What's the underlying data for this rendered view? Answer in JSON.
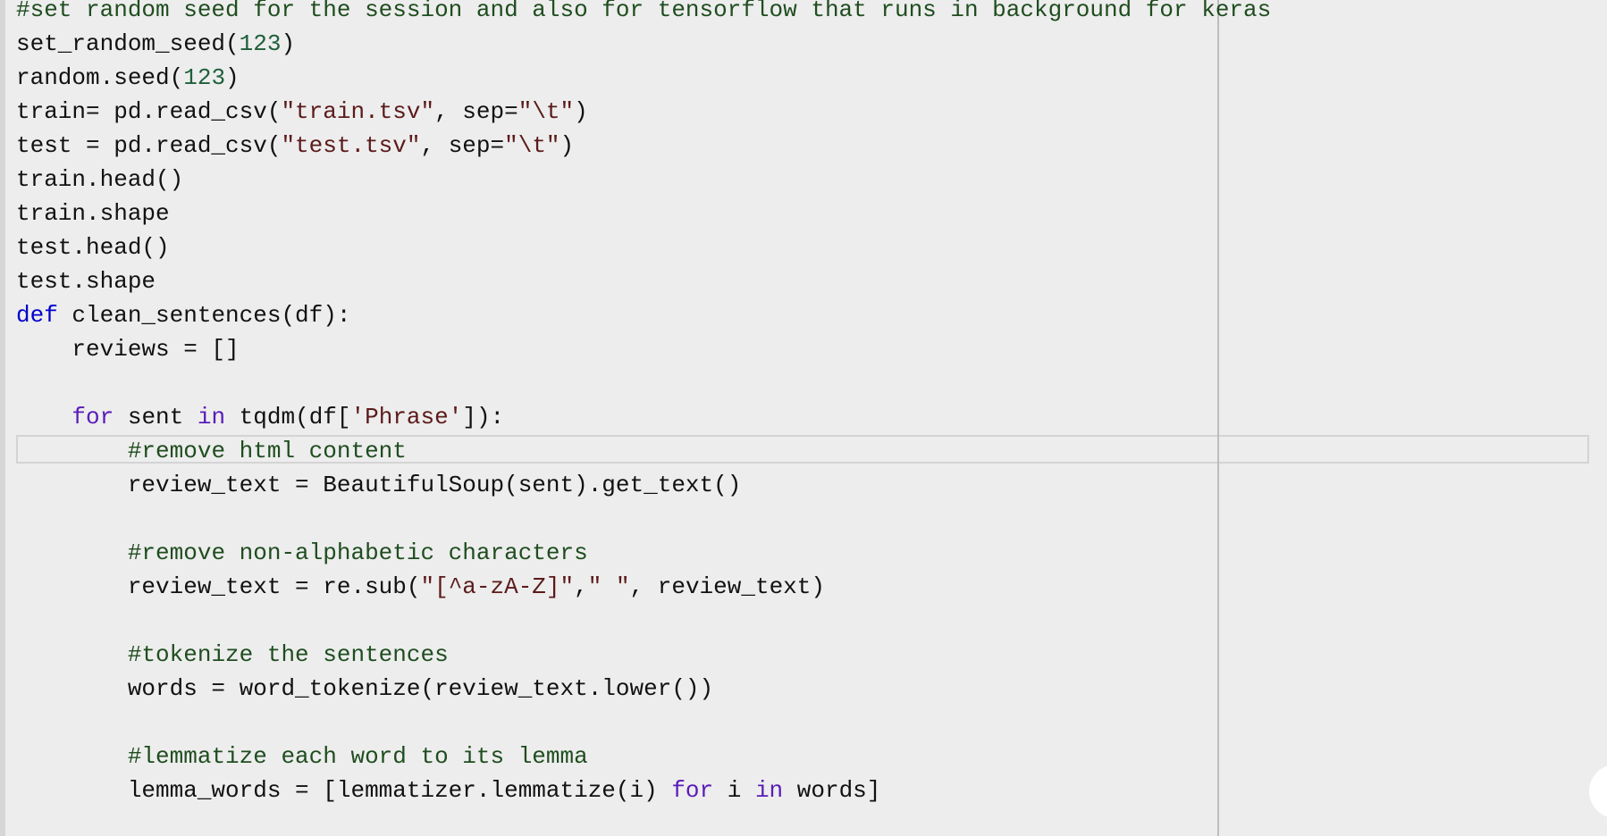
{
  "editor": {
    "lines": [
      [
        {
          "t": "#set random seed for the session and also for tensorflow that runs in background for keras",
          "c": "comment"
        }
      ],
      [
        {
          "t": "set_random_seed(",
          "c": ""
        },
        {
          "t": "123",
          "c": "num"
        },
        {
          "t": ")",
          "c": ""
        }
      ],
      [
        {
          "t": "random.seed(",
          "c": ""
        },
        {
          "t": "123",
          "c": "num"
        },
        {
          "t": ")",
          "c": ""
        }
      ],
      [
        {
          "t": "train= pd.read_csv(",
          "c": ""
        },
        {
          "t": "\"train.tsv\"",
          "c": "str"
        },
        {
          "t": ", sep=",
          "c": ""
        },
        {
          "t": "\"\\t\"",
          "c": "str"
        },
        {
          "t": ")",
          "c": ""
        }
      ],
      [
        {
          "t": "test = pd.read_csv(",
          "c": ""
        },
        {
          "t": "\"test.tsv\"",
          "c": "str"
        },
        {
          "t": ", sep=",
          "c": ""
        },
        {
          "t": "\"\\t\"",
          "c": "str"
        },
        {
          "t": ")",
          "c": ""
        }
      ],
      [
        {
          "t": "train.head()",
          "c": ""
        }
      ],
      [
        {
          "t": "train.shape",
          "c": ""
        }
      ],
      [
        {
          "t": "test.head()",
          "c": ""
        }
      ],
      [
        {
          "t": "test.shape",
          "c": ""
        }
      ],
      [
        {
          "t": "def",
          "c": "kw"
        },
        {
          "t": " clean_sentences(df):",
          "c": ""
        }
      ],
      [
        {
          "t": "    reviews = []",
          "c": ""
        }
      ],
      [
        {
          "t": "",
          "c": ""
        }
      ],
      [
        {
          "t": "    ",
          "c": ""
        },
        {
          "t": "for",
          "c": "kw2"
        },
        {
          "t": " sent ",
          "c": ""
        },
        {
          "t": "in",
          "c": "kw2"
        },
        {
          "t": " tqdm(df[",
          "c": ""
        },
        {
          "t": "'Phrase'",
          "c": "str"
        },
        {
          "t": "]):",
          "c": ""
        }
      ],
      [
        {
          "t": "        ",
          "c": ""
        },
        {
          "t": "#remove html content",
          "c": "comment"
        }
      ],
      [
        {
          "t": "        review_text = BeautifulSoup(sent).get_text()",
          "c": ""
        }
      ],
      [
        {
          "t": "",
          "c": ""
        }
      ],
      [
        {
          "t": "        ",
          "c": ""
        },
        {
          "t": "#remove non-alphabetic characters",
          "c": "comment"
        }
      ],
      [
        {
          "t": "        review_text = re.sub(",
          "c": ""
        },
        {
          "t": "\"[^a-zA-Z]\"",
          "c": "str"
        },
        {
          "t": ",",
          "c": ""
        },
        {
          "t": "\" \"",
          "c": "str"
        },
        {
          "t": ", review_text)",
          "c": ""
        }
      ],
      [
        {
          "t": "",
          "c": ""
        }
      ],
      [
        {
          "t": "        ",
          "c": ""
        },
        {
          "t": "#tokenize the sentences",
          "c": "comment"
        }
      ],
      [
        {
          "t": "        words = word_tokenize(review_text.lower())",
          "c": ""
        }
      ],
      [
        {
          "t": "",
          "c": ""
        }
      ],
      [
        {
          "t": "        ",
          "c": ""
        },
        {
          "t": "#lemmatize each word to its lemma",
          "c": "comment"
        }
      ],
      [
        {
          "t": "        lemma_words = [lemmatizer.lemmatize(i) ",
          "c": ""
        },
        {
          "t": "for",
          "c": "kw2"
        },
        {
          "t": " i ",
          "c": ""
        },
        {
          "t": "in",
          "c": "kw2"
        },
        {
          "t": " words]",
          "c": ""
        }
      ]
    ]
  }
}
